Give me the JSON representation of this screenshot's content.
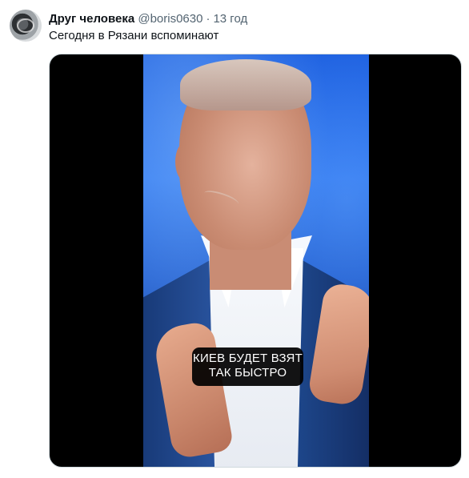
{
  "post": {
    "display_name": "Друг человека",
    "handle": "@boris0630",
    "separator": "·",
    "time": "13 год",
    "text": "Сегодня в Рязани вспоминают"
  },
  "media": {
    "caption_line_1": "КИЕВ БУДЕТ ВЗЯТ",
    "caption_line_2": "ТАК БЫСТРО"
  },
  "colors": {
    "name": "#0f1419",
    "secondary": "#536471",
    "media_background": "#000000"
  }
}
